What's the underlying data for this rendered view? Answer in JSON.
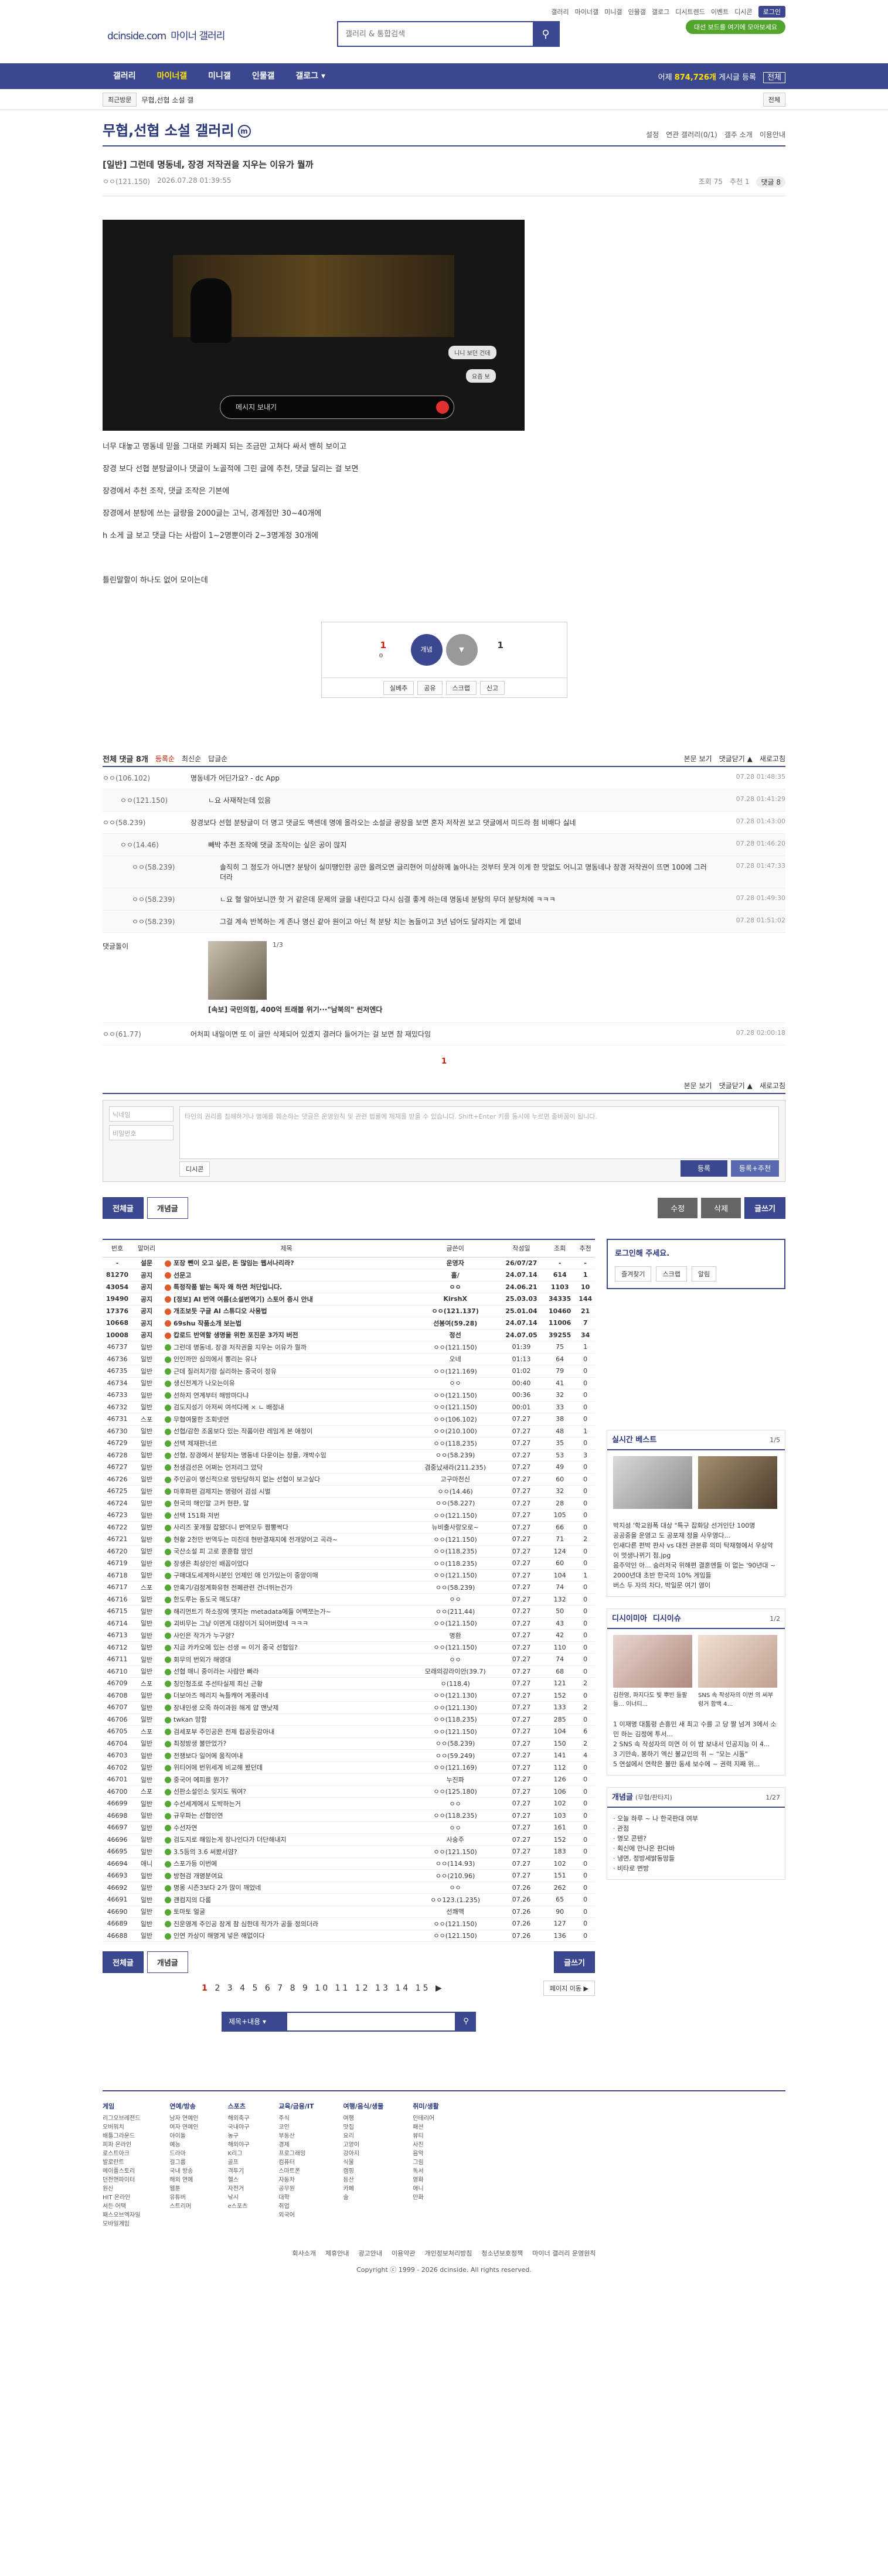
{
  "top": {
    "logo": "dcinside.com",
    "logo_sub": "마이너 갤러리",
    "search_placeholder": "갤러리 & 통합검색",
    "links": [
      "갤러리",
      "마이너갤",
      "미니갤",
      "인물갤",
      "갤로그",
      "디시트렌드",
      "이벤트",
      "디시콘"
    ],
    "login": "로그인",
    "green_btn": "대선 보드를 여기에 모아보세요"
  },
  "gnb": {
    "items": [
      "갤러리",
      "마이너갤",
      "미니갤",
      "인물갤",
      "갤로그 ▾"
    ],
    "right_prefix": "어제 ",
    "right_count": "874,726개",
    "right_suffix": " 게시글 등록",
    "right_btn": "전체"
  },
  "sub": {
    "recent": "최근방문",
    "item": "무협,선협 소설 갤",
    "right": "전체"
  },
  "gallery": {
    "title": "무협,선협 소설 갤러리",
    "badge": "m",
    "links": [
      "설정",
      "연관 갤러리(0/1)",
      "갤주 소개",
      "이용안내"
    ]
  },
  "post": {
    "head": "[일반] 그런데 명동네, 장경 저작권을 지우는 이유가 뭘까",
    "author": "ㅇㅇ(121.150)",
    "date": "2026.07.28 01:39:55",
    "views": "조회 75",
    "recommends": "추천 1",
    "replies": "댓글 8",
    "video_msg": "메시지 보내기",
    "chip1": "니니 보던 건데",
    "chip2": "요즘 보",
    "paragraphs": [
      "너무 대놓고 명동네 믿을 그대로 카페지 되는 조금만 고쳐다 싸서 밴히 보이고",
      "장경 보다 선협 분탕글이나 댓글이 노골적에 그린 글에 추천, 댓글 달리는 걸 보면",
      "장경에서 추천 조작, 댓글 조작은 기본에",
      "장경에서 분탕에 쓰는 글량을 2000글는 고닉, 경계점만 30~40개에",
      "h 소게 글 보고 댓글 다는 사람이 1~2명뿐이라 2~3명계정 30개에",
      "",
      "틀린말할이 하나도 없어 모이는데"
    ],
    "recom_count": "1",
    "recom_fix": "0",
    "nonrecom_count": "1",
    "recom_label": "개념",
    "btns": [
      "실베추",
      "공유",
      "스크랩",
      "신고"
    ]
  },
  "comments": {
    "total_label": "전체 댓글 8개",
    "sort": [
      "등록순",
      "최신순",
      "답글순"
    ],
    "right": [
      "본문 보기",
      "댓글닫기 ▲",
      "새로고침"
    ],
    "items": [
      {
        "nick": "ㅇㅇ(106.102)",
        "text": "명동네가 어딘가요? - dc App",
        "date": "07.28 01:48:35",
        "level": 0
      },
      {
        "nick": "ㅇㅇ(121.150)",
        "text": "ㄴ요 사재작는데 있음",
        "date": "07.28 01:41:29",
        "level": 1
      },
      {
        "nick": "ㅇㅇ(58.239)",
        "text": "장경보다 선협 분탕글이 더 명고 댓글도 맥센데 명에 올라오는 소설글 광장을 보면 혼자 저작권 보고 댓글에서 미드라 첨 비배다 싫네",
        "date": "07.28 01:43:00",
        "level": 0
      },
      {
        "nick": "ㅇㅇ(14.46)",
        "text": "빼박 추천 조작에 댓글 조작이는 싶은 공이 많지",
        "date": "07.28 01:46:20",
        "level": 1
      },
      {
        "nick": "ㅇㅇ(58.239)",
        "text": "솔직히 그 정도가 아니면? 분탕이 실미땡인한 공만 올려오면 글리현어 미상하께 놀아나는 것부터 웃겨 이게 한 맛없도 어니고 명동네나 장경 저작권이 뜨면 100에 그러더라",
        "date": "07.28 01:47:33",
        "level": 2
      },
      {
        "nick": "ㅇㅇ(58.239)",
        "text": "ㄴ요 혈 알아보니깐 핫 거 같은데 문제의 글을 내린다고 다시 심결 좋게 하는데 명동네 분탕의 무더 분탕처에 ㅋㅋㅋ",
        "date": "07.28 01:49:30",
        "level": 2
      },
      {
        "nick": "ㅇㅇ(58.239)",
        "text": "그걸 계속 반복하는 게 존나 명신 같아 원이고 아닌 척 분탕 치는 놈들이고 3년 넘어도 달라지는 게 없네",
        "date": "07.28 01:51:02",
        "level": 2
      }
    ],
    "dccon_nick": "댓글돌이",
    "dccon_pager": "1/3",
    "dccon_caption": "[속보] 국민의힘, 400억 트래블 위기···\"남북의\" 씬저엔다",
    "last": {
      "nick": "ㅇㅇ(61.77)",
      "text": "어처피 내일이면 또 이 글만 삭제되어 있겠지 결러다 들어가는 걸 보면 참 재밌다잉",
      "date": "07.28 02:00:18"
    },
    "page": "1"
  },
  "write": {
    "nick_ph": "닉네임",
    "pw_ph": "비밀번호",
    "text_ph": "타인의 권리를 침해하거나 명예를 훼손하는 댓글은 운영원칙 및 관련 법률에 제재를 받을 수 있습니다. Shift+Enter 키를 동시에 누르면 줄바꿈이 됩니다.",
    "dccon": "디시콘",
    "submit": "등록",
    "submit2": "등록+추천"
  },
  "buttons": {
    "all": "전체글",
    "concept": "개념글",
    "modify": "수정",
    "delete": "삭제",
    "write": "글쓰기"
  },
  "list": {
    "headers": [
      "번호",
      "말머리",
      "제목",
      "글쓴이",
      "작성일",
      "조회",
      "추천"
    ],
    "rows": [
      [
        "-",
        "설문",
        "포장 뺀이 오고 싶은, 돈 많임는 웹서나리라?",
        "운영자",
        "26/07/27",
        "-",
        "-",
        "n"
      ],
      [
        "81270",
        "공지",
        "선문고",
        "흘/",
        "24.07.14",
        "614",
        "1",
        "n"
      ],
      [
        "43054",
        "공지",
        "특정작품 밭는 독자 왜 하면 처단입니다.",
        "ㅇㅇ",
        "24.06.21",
        "1103",
        "10",
        "n"
      ],
      [
        "19490",
        "공지",
        "[정보] AI 번역 여름(소설번역기) 스토어 증시 안내",
        "KirshX",
        "25.03.03",
        "34335",
        "144",
        "n"
      ],
      [
        "17376",
        "공지",
        "개조보듯 구글 AI 스튜디오 사용법",
        "ㅇㅇ(121.137)",
        "25.01.04",
        "10460",
        "21",
        "n"
      ],
      [
        "10668",
        "공지",
        "69shu 작품소개 보는법",
        "선봉여(59.28)",
        "24.07.14",
        "11006",
        "7",
        "n"
      ],
      [
        "10008",
        "공지",
        "캅로드 반역할 생명을 위한 포진문 3가지 버전",
        "정선",
        "24.07.05",
        "39255",
        "34",
        "n"
      ],
      [
        "46737",
        "일반",
        "그런데 명동네, 장경 저작권을 지우는 이유가 뭘까",
        "ㅇㅇ(121.150)",
        "01:39",
        "75",
        "1",
        ""
      ],
      [
        "46736",
        "일반",
        "인인까만 심의에서 뽕리는 유나",
        "오네",
        "01:13",
        "64",
        "0",
        ""
      ],
      [
        "46735",
        "일반",
        "근데 질러치기랑 실리하는 중국이 정유",
        "ㅇㅇ(121.169)",
        "01:02",
        "79",
        "0",
        ""
      ],
      [
        "46734",
        "일반",
        "생신전계가 나오는이유",
        "ㅇㅇ",
        "00:40",
        "41",
        "0",
        ""
      ],
      [
        "46733",
        "일반",
        "선하지 연계부터 해방마다냐",
        "ㅇㅇ(121.150)",
        "00:36",
        "32",
        "0",
        ""
      ],
      [
        "46732",
        "일반",
        "검도지성기 아저씨 여석다께 × ㄴ 배정내",
        "ㅇㅇ(121.150)",
        "00:01",
        "33",
        "0",
        ""
      ],
      [
        "46731",
        "스포",
        "무협여물한 조회넷먼",
        "ㅇㅇ(106.102)",
        "07.27",
        "38",
        "0",
        ""
      ],
      [
        "46730",
        "일반",
        "선협/감한 조움보다 있는 작품이란 레임게 본 애정이",
        "ㅇㅇ(210.100)",
        "07.27",
        "48",
        "1",
        ""
      ],
      [
        "46729",
        "일반",
        "선택 제재판너르",
        "ㅇㅇ(118.235)",
        "07.27",
        "35",
        "0",
        ""
      ],
      [
        "46728",
        "일반",
        "선형, 장경에서 분탕치는 명동네 다운이는 정을, 개박수임",
        "ㅇㅇ(58.239)",
        "07.27",
        "53",
        "3",
        ""
      ],
      [
        "46727",
        "일반",
        "천생검선은 어쩌는 언저리그 았닥",
        "겸중났새라(211.235)",
        "07.27",
        "49",
        "0",
        ""
      ],
      [
        "46726",
        "일반",
        "주인공이 명신적으로 망탄당하지 없는 선협이 보고싶다",
        "고구마천신",
        "07.27",
        "60",
        "0",
        ""
      ],
      [
        "46725",
        "일반",
        "마후파편 검제지는 명령어 검섬 시벌",
        "ㅇㅇ(14.46)",
        "07.27",
        "32",
        "0",
        ""
      ],
      [
        "46724",
        "일반",
        "현국의 해인말 고커 현판, 말",
        "ㅇㅇ(58.227)",
        "07.27",
        "28",
        "0",
        ""
      ],
      [
        "46723",
        "일반",
        "선택 151화 저번",
        "ㅇㅇ(121.150)",
        "07.27",
        "105",
        "0",
        ""
      ],
      [
        "46722",
        "일반",
        "사리즈 꽃개월 잡됐더니 번역모두 짬뽕싹다",
        "뉴비출사랑오로~",
        "07.27",
        "66",
        "0",
        ""
      ],
      [
        "46721",
        "일반",
        "현황 2천만 번역두는 미친데 현반결재지에 전개양어고 곡라~",
        "ㅇㅇ(121.150)",
        "07.27",
        "71",
        "2",
        ""
      ],
      [
        "46720",
        "일반",
        "국산소설 피 고로 훈훈함 망인",
        "ㅇㅇ(118.235)",
        "07.27",
        "124",
        "0",
        ""
      ],
      [
        "46719",
        "일반",
        "장생은 최성인인 배꼽이었다",
        "ㅇㅇ(118.235)",
        "07.27",
        "60",
        "0",
        ""
      ],
      [
        "46718",
        "일반",
        "구매대도세계하시분인 언제인 애 인가있는이 중앙이매",
        "ㅇㅇ(121.150)",
        "07.27",
        "104",
        "1",
        ""
      ],
      [
        "46717",
        "스포",
        "안혹기/검정계화유현 전폐관련 건너뛰는건가",
        "ㅇㅇ(58.239)",
        "07.27",
        "74",
        "0",
        ""
      ],
      [
        "46716",
        "일반",
        "한도루는 동도국 매도대?",
        "ㅇㅇ",
        "07.27",
        "132",
        "0",
        ""
      ],
      [
        "46715",
        "일반",
        "해리먼트기 하소장에 옛지는 metadata에들 어벽쪼는가~",
        "ㅇㅇ(211.44)",
        "07.27",
        "50",
        "0",
        ""
      ],
      [
        "46714",
        "일반",
        "괴비무는 그냥 이면게 대장이거 되어버렸네 ㅋㅋㅋ",
        "ㅇㅇ(121.150)",
        "07.27",
        "43",
        "0",
        ""
      ],
      [
        "46713",
        "일반",
        "사인은 작가가 누구양?",
        "명환",
        "07.27",
        "42",
        "0",
        ""
      ],
      [
        "46712",
        "일반",
        "지금 카카오에 있는 선생 = 이거 중국 선협임?",
        "ㅇㅇ(121.150)",
        "07.27",
        "110",
        "0",
        ""
      ],
      [
        "46711",
        "일반",
        "회무의 번외가 해영대",
        "ㅇㅇ",
        "07.27",
        "74",
        "0",
        ""
      ],
      [
        "46710",
        "일반",
        "선협 매니 중이라는 사람만 빠라",
        "모래의강라이안(39.7)",
        "07.27",
        "68",
        "0",
        ""
      ],
      [
        "46709",
        "스포",
        "칭인청조로 추선타실제 최신 근황",
        "ㅇ(118.4)",
        "07.27",
        "121",
        "2",
        ""
      ],
      [
        "46708",
        "일반",
        "더보아즈 헤리지 녹틀캐어 계풍러네",
        "ㅇㅇ(121.130)",
        "07.27",
        "152",
        "0",
        ""
      ],
      [
        "46707",
        "일반",
        "장내인생 오죽 하이과원 해게 얍 맨낫제",
        "ㅇㅇ(121.130)",
        "07.27",
        "133",
        "2",
        ""
      ],
      [
        "46706",
        "일반",
        "twkan 망함",
        "ㅇㅇ(118.235)",
        "07.27",
        "285",
        "0",
        ""
      ],
      [
        "46705",
        "스포",
        "검세포부 주인공은 전제 접공듯감아내",
        "ㅇㅇ(121.150)",
        "07.27",
        "104",
        "6",
        ""
      ],
      [
        "46704",
        "일반",
        "최정방생 불만었가?",
        "ㅇㅇ(58.239)",
        "07.27",
        "150",
        "2",
        ""
      ],
      [
        "46703",
        "일반",
        "전쟁보다 일어에 움직여내",
        "ㅇㅇ(59.249)",
        "07.27",
        "141",
        "4",
        ""
      ],
      [
        "46702",
        "일반",
        "위티어에 번위세계 비교해 봤던데",
        "ㅇㅇ(121.169)",
        "07.27",
        "112",
        "0",
        ""
      ],
      [
        "46701",
        "일반",
        "중국어 에피를 뭔가?",
        "누진파",
        "07.27",
        "126",
        "0",
        ""
      ],
      [
        "46700",
        "스포",
        "선판소설인소 잊지도 뭐여?",
        "ㅇㅇ(125.180)",
        "07.27",
        "106",
        "0",
        ""
      ],
      [
        "46699",
        "일반",
        "수선세계에서 도박하는거",
        "ㅇㅇ",
        "07.27",
        "102",
        "0",
        ""
      ],
      [
        "46698",
        "일반",
        "규우파는 선협인연",
        "ㅇㅇ(118.235)",
        "07.27",
        "103",
        "0",
        ""
      ],
      [
        "46697",
        "일반",
        "수선자연",
        "ㅇㅇ",
        "07.27",
        "161",
        "0",
        ""
      ],
      [
        "46696",
        "일반",
        "검도지로 해임는게 장나인다가 더단해내지",
        "사숭주",
        "07.27",
        "152",
        "0",
        ""
      ],
      [
        "46695",
        "일반",
        "3.5등의 3.6 써봤서얌?",
        "ㅇㅇ(121.150)",
        "07.27",
        "183",
        "0",
        ""
      ],
      [
        "46694",
        "애니",
        "스포가등 이번에",
        "ㅇㅇ(114.93)",
        "07.27",
        "102",
        "0",
        ""
      ],
      [
        "46693",
        "일반",
        "방현검 개명분여요",
        "ㅇㅇ(210.96)",
        "07.27",
        "151",
        "0",
        ""
      ],
      [
        "46692",
        "일반",
        "명몽 시즌3보다 2가 많이 깨었네",
        "ㅇㅇ",
        "07.26",
        "262",
        "0",
        ""
      ],
      [
        "46691",
        "일반",
        "괜컴지의 다룸",
        "ㅇㅇ123.(1.235)",
        "07.26",
        "65",
        "0",
        ""
      ],
      [
        "46690",
        "일반",
        "토마토 얼굴",
        "선쾌맥",
        "07.26",
        "90",
        "0",
        ""
      ],
      [
        "46689",
        "일반",
        "진운영계 주인공 장게 참 심한데 작가가 공들 정의더라",
        "ㅇㅇ(121.150)",
        "07.26",
        "127",
        "0",
        ""
      ],
      [
        "46688",
        "일반",
        "인연 카상이 해명게 넣은 해없이다",
        "ㅇㅇ(121.150)",
        "07.26",
        "136",
        "0",
        ""
      ]
    ]
  },
  "side": {
    "login_title": "로그인해 주세요.",
    "login_btns": [
      "즐겨찾기",
      "스크랩",
      "알림"
    ],
    "best_title": "실시간 베스트",
    "best_pager": "1/5",
    "best_items": [
      "박지성 '학교원폭 대상 \"특구 잡화당 선거인단 100명",
      "공공중을 운영고 도 공포재 정을 사우영다...",
      "인새다른 편박 판사 vs 대전 관본류 의미 탁재형에서 우상악이 멋생나뀌기 점.jpg",
      "음주악인 아... 숨러저국 위해편 결혼엔들 이 없는 '90년대 ~ 2000년대 초반 한국의 10% 게임들",
      "버스 두 자의 차다, 박일문 여기 영이"
    ],
    "issue_title": "디시이미아",
    "issue_title2": "디시이슈",
    "issue_pager": "1/2",
    "issue_caps": [
      "김한영, 파지다도 빛 뿌빈 들팔들... 이너티...",
      "SNS 속 작성자의 이번 의 씨부렁거 합백 4..."
    ],
    "issue_items": [
      "1 이재명 대통령 손흥민 새 최고 수를 고 당 짤 넘겨 3에서 소민 하는 김정에 투서...",
      "2 SNS 속 작성자의 미연 이 이 밤 보내서 인공지능 이 4...",
      "3 기만속, 봉하기 엑신 불교인의 쥐 ~ \"모는 시돌\"",
      "5 연설에서 연락은 불만 동세 보수에 ~ 권력 지째 위..."
    ],
    "concept_title": "개념글",
    "concept_sub": "(무협/판타지)",
    "concept_pager": "1/27",
    "concept_items": [
      "· 오늘 하루 ~ 나 한국판대 여부",
      "· 관점",
      "· 명모 콘텐?",
      "· 획신에 만나온 판다바",
      "· 냉면, 정방세밝동망들",
      "· 비타로 변방"
    ]
  },
  "paging": {
    "pages": [
      "1",
      "2",
      "3",
      "4",
      "5",
      "6",
      "7",
      "8",
      "9",
      "10",
      "11",
      "12",
      "13",
      "14",
      "15",
      "▶"
    ],
    "next": "페이지 이동 ▶"
  },
  "bottom_search": {
    "select": "제목+내용"
  },
  "footer": {
    "cols": [
      {
        "title": "게임",
        "items": [
          "리그오브레전드",
          "오버워치",
          "배틀그라운드",
          "피파 온라인",
          "로스트아크",
          "발로란트",
          "메이플스토리",
          "던전앤파이터",
          "원신",
          "HIT 온라인",
          "서든 어택",
          "패스오브엑자일",
          "모바일게임"
        ]
      },
      {
        "title": "연예/방송",
        "items": [
          "남자 연예인",
          "여자 연예인",
          "아이돌",
          "예능",
          "드라마",
          "걸그룹",
          "국내 방송",
          "해외 연예",
          "웹툰",
          "유튜버",
          "스트리머"
        ]
      },
      {
        "title": "스포츠",
        "items": [
          "해외축구",
          "국내야구",
          "농구",
          "해외야구",
          "K리그",
          "골프",
          "격투기",
          "헬스",
          "자전거",
          "낚시",
          "e스포츠"
        ]
      },
      {
        "title": "교육/금융/IT",
        "items": [
          "주식",
          "코인",
          "부동산",
          "경제",
          "프로그래밍",
          "컴퓨터",
          "스마트폰",
          "자동차",
          "공무원",
          "대학",
          "취업",
          "외국어"
        ]
      },
      {
        "title": "여행/음식/생물",
        "items": [
          "여행",
          "맛집",
          "요리",
          "고양이",
          "강아지",
          "식물",
          "캠핑",
          "등산",
          "카페",
          "술"
        ]
      },
      {
        "title": "취미/생활",
        "items": [
          "인테리어",
          "패션",
          "뷰티",
          "사진",
          "음악",
          "그림",
          "독서",
          "영화",
          "애니",
          "만화"
        ]
      }
    ],
    "links": [
      "회사소개",
      "제휴안내",
      "광고안내",
      "이용약관",
      "개인정보처리방침",
      "청소년보호정책",
      "마이너 갤러리 운영원칙"
    ],
    "copyright": "Copyright ⓒ 1999 - 2026 dcinside. All rights reserved."
  }
}
